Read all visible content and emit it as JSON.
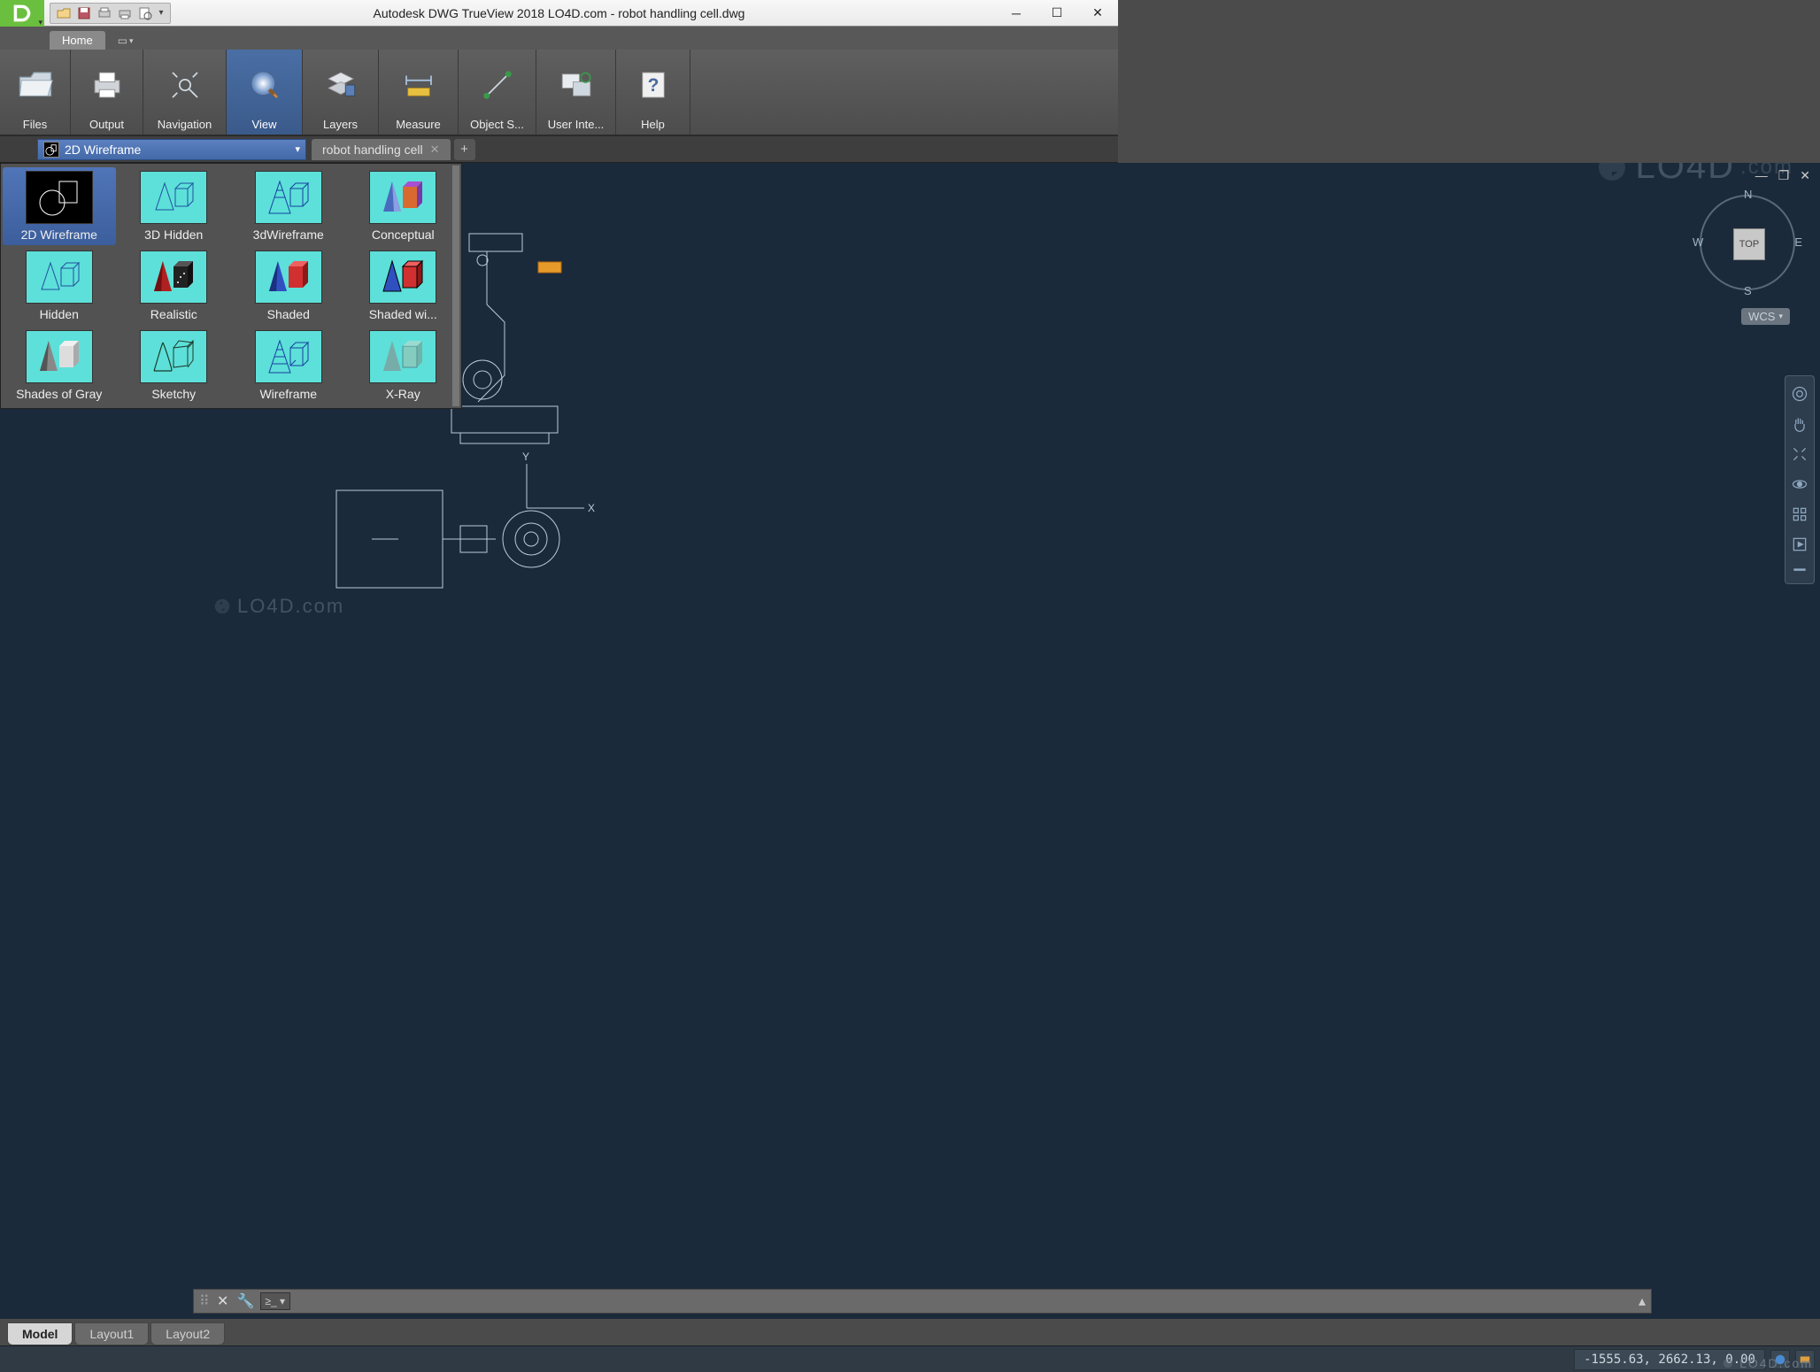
{
  "title": "Autodesk DWG TrueView 2018     LO4D.com - robot handling cell.dwg",
  "ribbon": {
    "tab": "Home",
    "panels": [
      {
        "label": "Files"
      },
      {
        "label": "Output"
      },
      {
        "label": "Navigation"
      },
      {
        "label": "View"
      },
      {
        "label": "Layers"
      },
      {
        "label": "Measure"
      },
      {
        "label": "Object S..."
      },
      {
        "label": "User Inte..."
      },
      {
        "label": "Help"
      }
    ],
    "active_panel": "View"
  },
  "visual_style_selected": "2D Wireframe",
  "document_tab": "robot handling cell",
  "visual_styles": [
    "2D Wireframe",
    "3D Hidden",
    "3dWireframe",
    "Conceptual",
    "Hidden",
    "Realistic",
    "Shaded",
    "Shaded wi...",
    "Shades of Gray",
    "Sketchy",
    "Wireframe",
    "X-Ray"
  ],
  "viewcube": {
    "top": "TOP",
    "n": "N",
    "s": "S",
    "e": "E",
    "w": "W"
  },
  "wcs_label": "WCS",
  "layout_tabs": [
    "Model",
    "Layout1",
    "Layout2"
  ],
  "active_layout": "Model",
  "axes": {
    "x": "X",
    "y": "Y"
  },
  "coords": "-1555.63, 2662.13, 0.00",
  "watermark": "LO4D.com",
  "watermark_suffix": ".com"
}
